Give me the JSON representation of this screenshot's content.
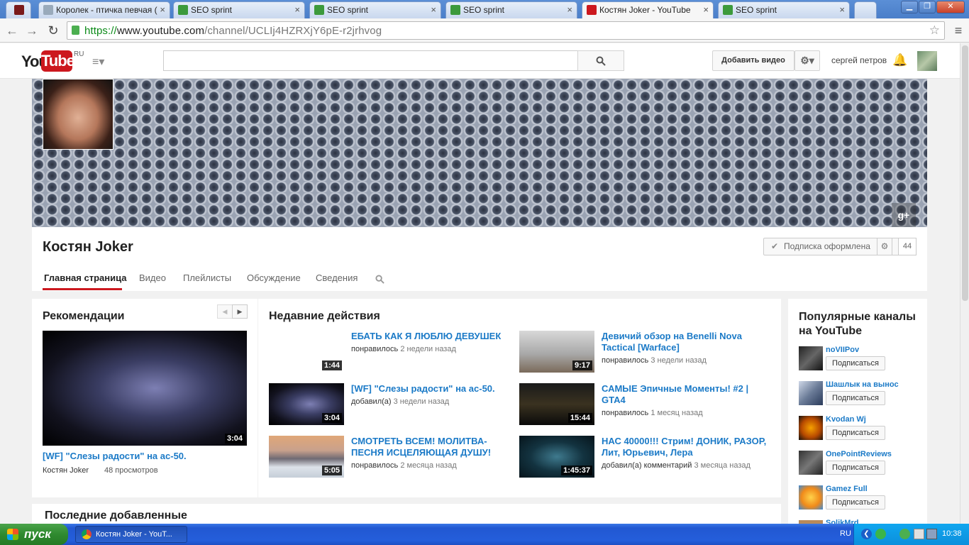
{
  "browser": {
    "tabs": [
      {
        "label": "",
        "color": "#7a1a1a"
      },
      {
        "label": "Королек - птичка певчая (",
        "color": "#9aa"
      },
      {
        "label": "SEO sprint",
        "color": "#3c9a3c"
      },
      {
        "label": "SEO sprint",
        "color": "#3c9a3c"
      },
      {
        "label": "SEO sprint",
        "color": "#3c9a3c"
      },
      {
        "label": "Костян Joker - YouTube",
        "color": "#cc181e"
      },
      {
        "label": "SEO sprint",
        "color": "#3c9a3c"
      }
    ],
    "url_scheme": "https://",
    "url_host": "www.youtube.com",
    "url_path": "/channel/UCLIj4HZRXjY6pE-r2jrhvog"
  },
  "header": {
    "logo_text": "You",
    "logo_tube": "Tube",
    "logo_region": "RU",
    "search_placeholder": "",
    "upload_label": "Добавить видео",
    "username": "сергей петров"
  },
  "channel": {
    "name": "Костян Joker",
    "subscribe_label": "Подписка оформлена",
    "subscriber_count": "44",
    "gplus": "g+",
    "tabs": [
      "Главная страница",
      "Видео",
      "Плейлисты",
      "Обсуждение",
      "Сведения"
    ]
  },
  "recommendations": {
    "title": "Рекомендации",
    "video_title": "[WF] \"Слезы радости\" на ас-50.",
    "duration": "3:04",
    "author": "Костян Joker",
    "views": "48 просмотров"
  },
  "activity": {
    "title": "Недавние действия",
    "items": [
      {
        "title": "ЕБАТЬ КАК Я ЛЮБЛЮ ДЕВУШЕК",
        "duration": "1:44",
        "action": "понравилось",
        "time": "2 недели назад"
      },
      {
        "title": "Девичий обзор на Benelli Nova Tactical [Warface]",
        "duration": "9:17",
        "action": "понравилось",
        "time": "3 недели назад"
      },
      {
        "title": "[WF] \"Слезы радости\" на ас-50.",
        "duration": "3:04",
        "action": "добавил(а)",
        "time": "3 недели назад"
      },
      {
        "title": "САМЫЕ Эпичные Моменты! #2 | GTA4",
        "duration": "15:44",
        "action": "понравилось",
        "time": "1 месяц назад"
      },
      {
        "title": "СМОТРЕТЬ ВСЕМ! МОЛИТВА-ПЕСНЯ ИСЦЕЛЯЮЩАЯ ДУШУ!",
        "duration": "5:05",
        "action": "понравилось",
        "time": "2 месяца назад"
      },
      {
        "title": "НАС 40000!!! Стрим! ДОНИК, РАЗОР, Лит, Юрьевич, Лера",
        "duration": "1:45:37",
        "action": "добавил(а) комментарий",
        "time": "3 месяца назад"
      }
    ]
  },
  "popular": {
    "title": "Популярные каналы на YouTube",
    "subscribe_label": "Подписаться",
    "channels": [
      "noVIIPov",
      "Шашлык на вынос",
      "Kvodan Wj",
      "OnePointReviews",
      "Gamez Full",
      "SolikMrd"
    ]
  },
  "latest": {
    "title": "Последние добавленные"
  },
  "taskbar": {
    "start_label": "пуск",
    "app_label": "Костян Joker - YouT...",
    "lang": "RU",
    "clock": "10:38"
  }
}
